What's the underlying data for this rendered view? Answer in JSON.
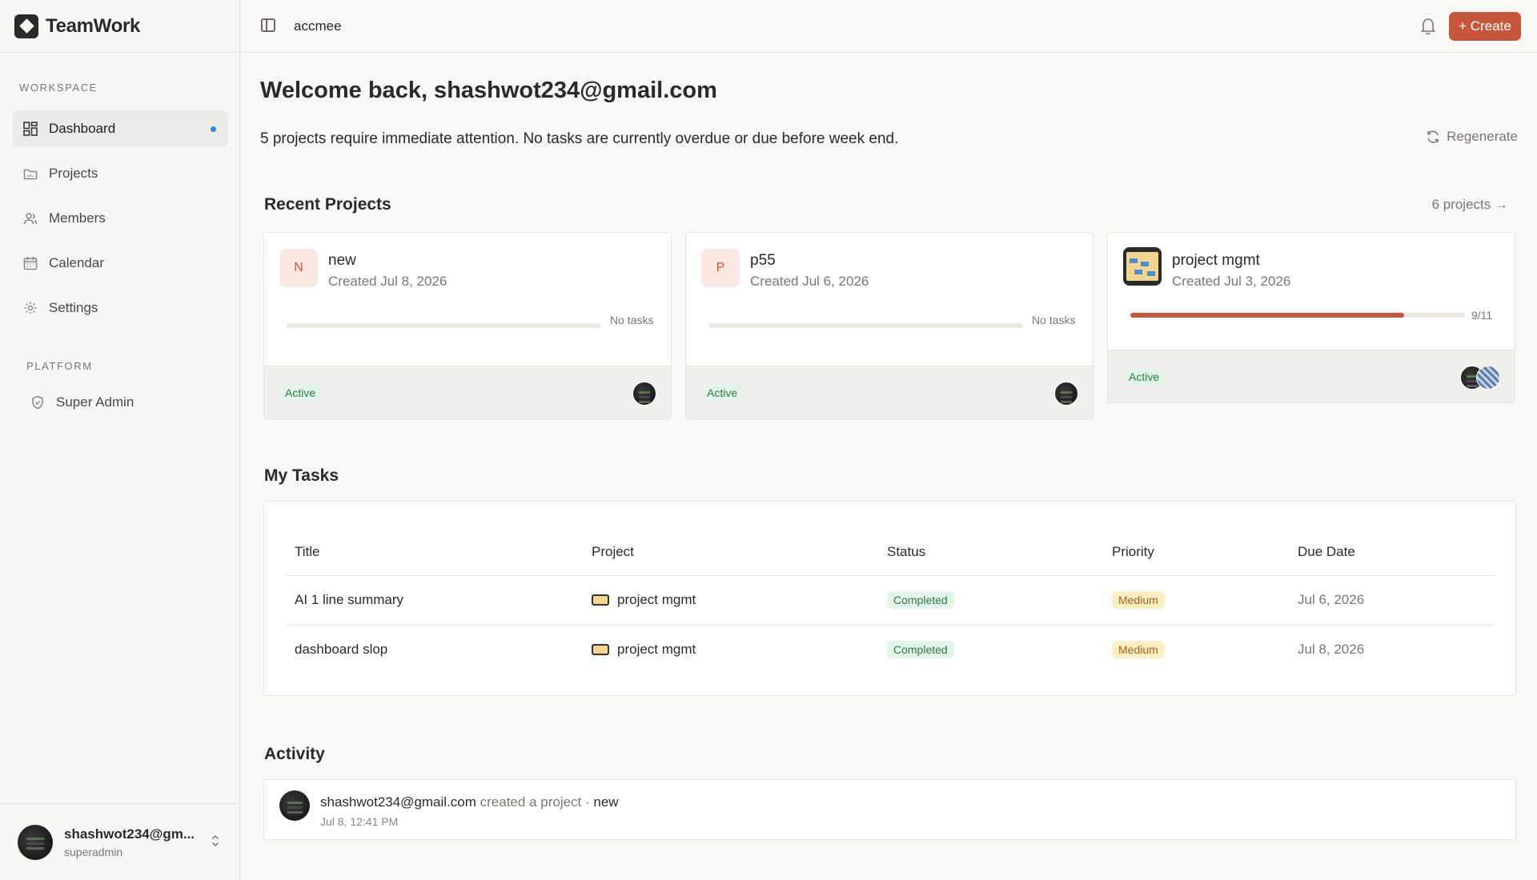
{
  "app": {
    "name": "TeamWork"
  },
  "topbar": {
    "workspace": "accmee",
    "create_label": "+ Create"
  },
  "sidebar": {
    "workspace_label": "WORKSPACE",
    "platform_label": "PLATFORM",
    "items": [
      {
        "label": "Dashboard",
        "icon": "dashboard-icon"
      },
      {
        "label": "Projects",
        "icon": "folder-icon"
      },
      {
        "label": "Members",
        "icon": "users-icon"
      },
      {
        "label": "Calendar",
        "icon": "calendar-icon"
      },
      {
        "label": "Settings",
        "icon": "gear-icon"
      }
    ],
    "platform_items": [
      {
        "label": "Super Admin",
        "icon": "shield-icon"
      }
    ],
    "user": {
      "name": "shashwot234@gm...",
      "role": "superadmin"
    }
  },
  "main": {
    "welcome": "Welcome back, shashwot234@gmail.com",
    "summary": "5 projects require immediate attention. No tasks are currently overdue or due before week end.",
    "regenerate": "Regenerate",
    "recent_title": "Recent Projects",
    "projects_link": "6 projects →",
    "projects": [
      {
        "initial": "N",
        "name": "new",
        "created": "Created Jul 8, 2026",
        "progress": 0,
        "progress_label": "No tasks",
        "status": "Active"
      },
      {
        "initial": "P",
        "name": "p55",
        "created": "Created Jul 6, 2026",
        "progress": 0,
        "progress_label": "No tasks",
        "status": "Active"
      },
      {
        "initial": "",
        "name": "project mgmt",
        "created": "Created Jul 3, 2026",
        "progress": 0.8181,
        "progress_label": "9/11",
        "status": "Active"
      }
    ],
    "tasks_title": "My Tasks",
    "tasks_columns": [
      "Title",
      "Project",
      "Status",
      "Priority",
      "Due Date"
    ],
    "tasks": [
      {
        "title": "AI 1 line summary",
        "project": "project mgmt",
        "status": "Completed",
        "priority": "Medium",
        "due": "Jul 6, 2026"
      },
      {
        "title": "dashboard slop",
        "project": "project mgmt",
        "status": "Completed",
        "priority": "Medium",
        "due": "Jul 8, 2026"
      }
    ],
    "activity_title": "Activity",
    "activity": [
      {
        "user": "shashwot234@gmail.com",
        "action": "created a project ·",
        "target": "new",
        "time": "Jul 8, 12:41 PM"
      }
    ]
  },
  "colors": {
    "accent": "#c7573b",
    "active_green": "#2c7a47",
    "medium_amber": "#a5621a",
    "dot_blue": "#2f86c9"
  }
}
